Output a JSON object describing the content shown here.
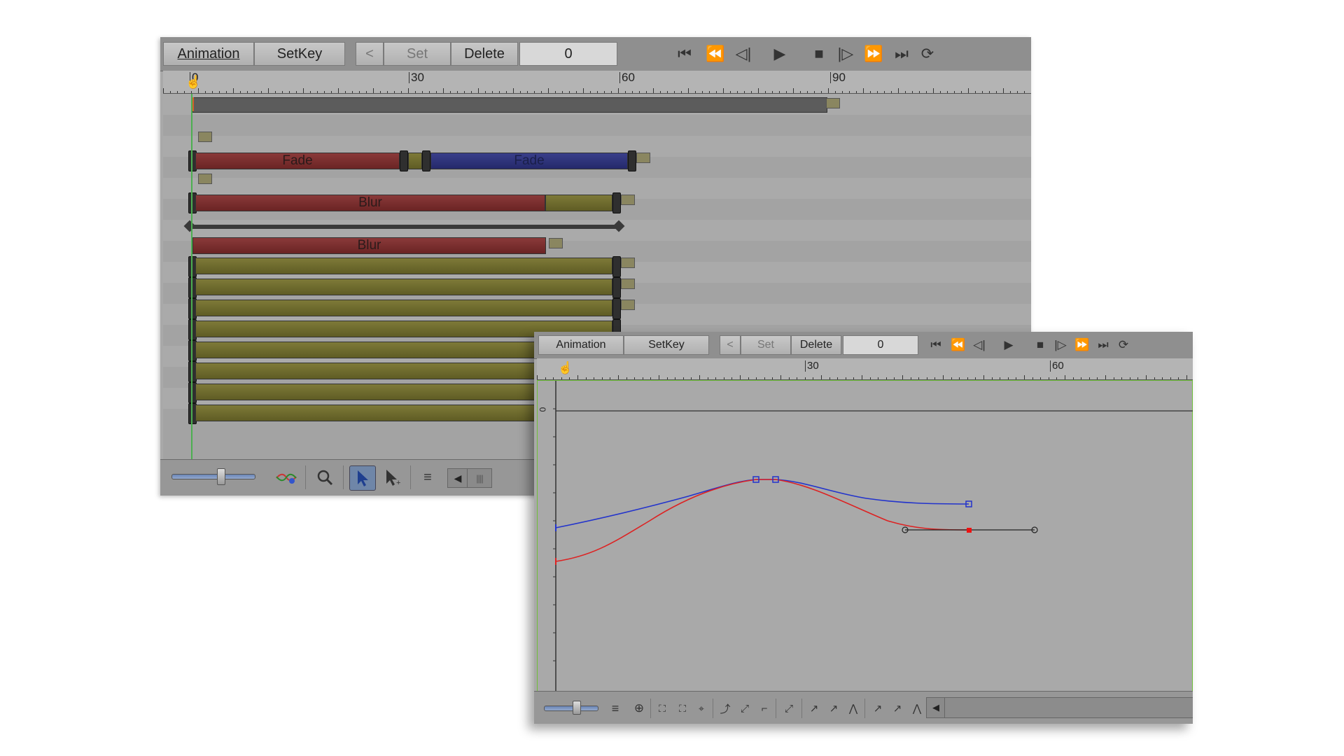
{
  "timeline": {
    "toolbar": {
      "animation_label": "Animation",
      "setkey_label": "SetKey",
      "prev_label": "<",
      "set_label": "Set",
      "delete_label": "Delete",
      "frame_value": "0"
    },
    "ruler": {
      "labels": [
        "0",
        "30",
        "60",
        "90"
      ]
    },
    "clips": {
      "fade_a": "Fade",
      "fade_b": "Fade",
      "blur_a": "Blur",
      "blur_b": "Blur"
    },
    "colors": {
      "clip_red": "#7a2e2e",
      "clip_blue": "#2e337a",
      "clip_olive": "#6f6b2e",
      "playhead": "#4caf50"
    }
  },
  "curve_editor": {
    "toolbar": {
      "animation_label": "Animation",
      "setkey_label": "SetKey",
      "prev_label": "<",
      "set_label": "Set",
      "delete_label": "Delete",
      "frame_value": "0"
    },
    "ruler": {
      "labels": [
        "30",
        "60"
      ]
    },
    "value_axis_label": "0",
    "curves": [
      {
        "color": "#2233cc"
      },
      {
        "color": "#dd2222"
      }
    ]
  }
}
